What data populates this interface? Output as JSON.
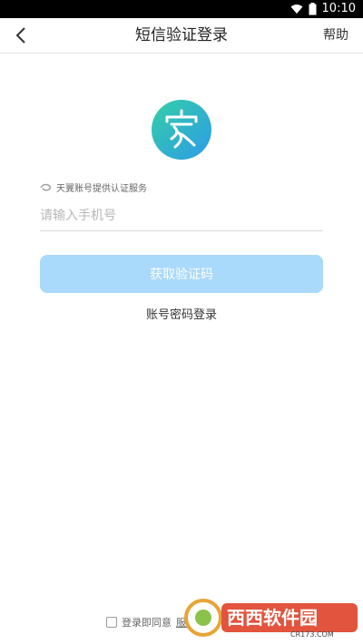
{
  "status_bar": {
    "time": "10:10"
  },
  "nav": {
    "title": "短信验证登录",
    "help": "帮助"
  },
  "provider_text": "天翼账号提供认证服务",
  "phone": {
    "placeholder": "请输入手机号",
    "value": ""
  },
  "get_code_button": "获取验证码",
  "password_login": "账号密码登录",
  "agreement": {
    "prefix": "登录即同意",
    "link": "服务"
  },
  "watermark": {
    "brand": "西西软件园",
    "url": "CR173.COM"
  },
  "colors": {
    "primary_button": "#a9d9fb",
    "logo_gradient_start": "#34cfa6",
    "logo_gradient_end": "#2d9be8"
  },
  "icons": {
    "back": "chevron-left-icon",
    "wifi": "wifi-icon",
    "battery": "battery-icon",
    "logo": "family-home-logo-icon",
    "provider": "tianyi-icon"
  }
}
